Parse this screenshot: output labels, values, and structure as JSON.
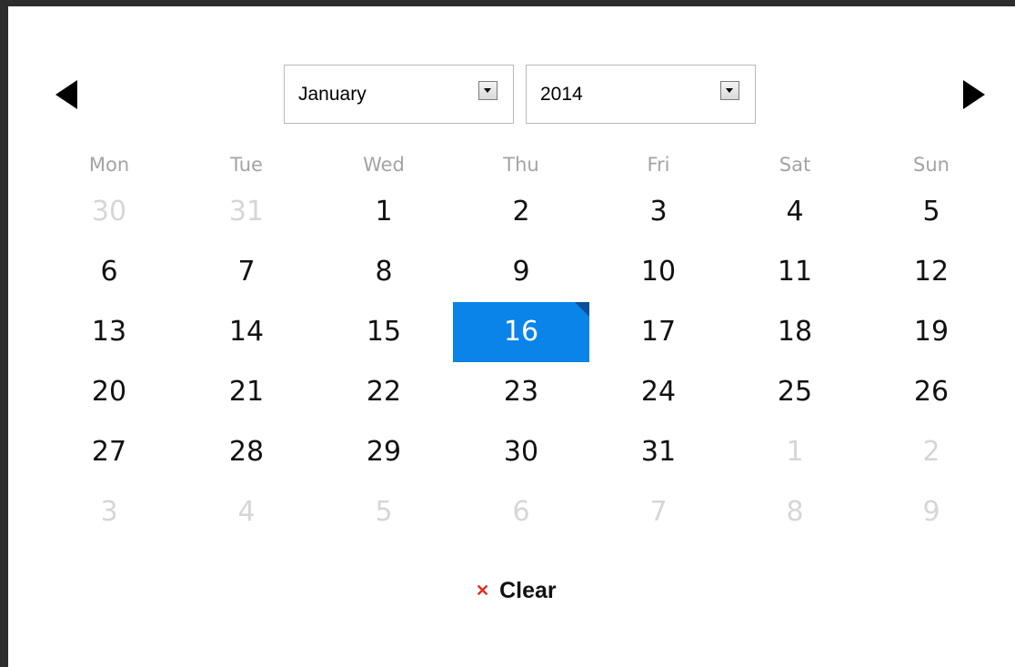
{
  "header": {
    "month": "January",
    "year": "2014"
  },
  "weekdays": [
    "Mon",
    "Tue",
    "Wed",
    "Thu",
    "Fri",
    "Sat",
    "Sun"
  ],
  "weeks": [
    [
      {
        "label": "30",
        "muted": true
      },
      {
        "label": "31",
        "muted": true
      },
      {
        "label": "1",
        "muted": false
      },
      {
        "label": "2",
        "muted": false
      },
      {
        "label": "3",
        "muted": false
      },
      {
        "label": "4",
        "muted": false
      },
      {
        "label": "5",
        "muted": false
      }
    ],
    [
      {
        "label": "6",
        "muted": false
      },
      {
        "label": "7",
        "muted": false
      },
      {
        "label": "8",
        "muted": false
      },
      {
        "label": "9",
        "muted": false
      },
      {
        "label": "10",
        "muted": false
      },
      {
        "label": "11",
        "muted": false
      },
      {
        "label": "12",
        "muted": false
      }
    ],
    [
      {
        "label": "13",
        "muted": false
      },
      {
        "label": "14",
        "muted": false
      },
      {
        "label": "15",
        "muted": false
      },
      {
        "label": "16",
        "muted": false,
        "selected": true
      },
      {
        "label": "17",
        "muted": false
      },
      {
        "label": "18",
        "muted": false
      },
      {
        "label": "19",
        "muted": false
      }
    ],
    [
      {
        "label": "20",
        "muted": false
      },
      {
        "label": "21",
        "muted": false
      },
      {
        "label": "22",
        "muted": false
      },
      {
        "label": "23",
        "muted": false
      },
      {
        "label": "24",
        "muted": false
      },
      {
        "label": "25",
        "muted": false
      },
      {
        "label": "26",
        "muted": false
      }
    ],
    [
      {
        "label": "27",
        "muted": false
      },
      {
        "label": "28",
        "muted": false
      },
      {
        "label": "29",
        "muted": false
      },
      {
        "label": "30",
        "muted": false
      },
      {
        "label": "31",
        "muted": false
      },
      {
        "label": "1",
        "muted": true
      },
      {
        "label": "2",
        "muted": true
      }
    ],
    [
      {
        "label": "3",
        "muted": true
      },
      {
        "label": "4",
        "muted": true
      },
      {
        "label": "5",
        "muted": true
      },
      {
        "label": "6",
        "muted": true
      },
      {
        "label": "7",
        "muted": true
      },
      {
        "label": "8",
        "muted": true
      },
      {
        "label": "9",
        "muted": true
      }
    ]
  ],
  "footer": {
    "clear_label": "Clear",
    "clear_icon": "close-icon"
  },
  "colors": {
    "selected": "#0a84e8",
    "clear_icon": "#e32b1c"
  }
}
